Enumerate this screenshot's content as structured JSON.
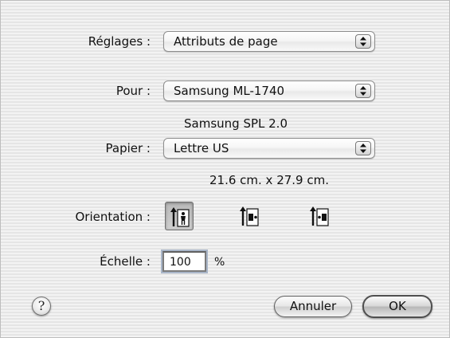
{
  "dialog": {
    "settings": {
      "label": "Réglages :",
      "value": "Attributs de page"
    },
    "format_for": {
      "label": "Pour :",
      "value": "Samsung ML-1740",
      "subtitle": "Samsung SPL 2.0"
    },
    "paper": {
      "label": "Papier :",
      "value": "Lettre US",
      "dimensions": "21.6 cm. x 27.9 cm."
    },
    "orientation": {
      "label": "Orientation :",
      "options": [
        {
          "icon": "portrait-icon",
          "selected": true
        },
        {
          "icon": "landscape-icon",
          "selected": false
        },
        {
          "icon": "landscape-reversed-icon",
          "selected": false
        }
      ]
    },
    "scale": {
      "label": "Échelle :",
      "value": "100",
      "unit": "%"
    },
    "buttons": {
      "help": "?",
      "cancel": "Annuler",
      "ok": "OK"
    }
  }
}
